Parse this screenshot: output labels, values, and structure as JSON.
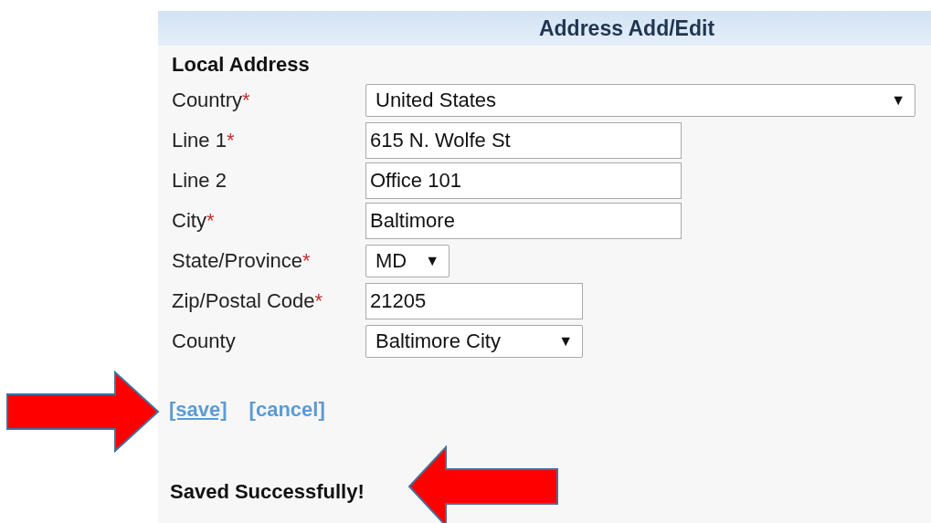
{
  "header": {
    "title": "Address Add/Edit"
  },
  "section": {
    "title": "Local Address"
  },
  "fields": [
    {
      "label": "Country",
      "required": true,
      "kind": "select",
      "value": "United States"
    },
    {
      "label": "Line 1",
      "required": true,
      "kind": "text",
      "value": "615 N. Wolfe St"
    },
    {
      "label": "Line 2",
      "required": false,
      "kind": "text",
      "value": "Office 101"
    },
    {
      "label": "City",
      "required": true,
      "kind": "text",
      "value": "Baltimore"
    },
    {
      "label": "State/Province",
      "required": true,
      "kind": "select",
      "value": "MD"
    },
    {
      "label": "Zip/Postal Code",
      "required": true,
      "kind": "text",
      "value": "21205"
    },
    {
      "label": "County",
      "required": false,
      "kind": "select",
      "value": "Baltimore City"
    }
  ],
  "required_mark": "*",
  "select_caret": "▼",
  "links": [
    {
      "label": "[save]",
      "focused": true
    },
    {
      "label": "[cancel]",
      "focused": false
    }
  ],
  "message": "Saved Successfully!"
}
